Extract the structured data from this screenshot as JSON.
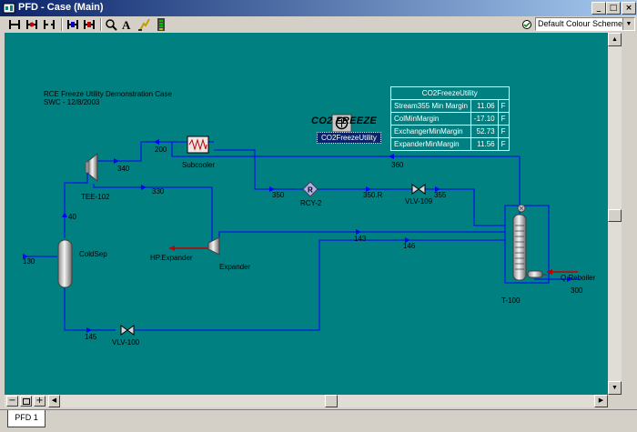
{
  "window": {
    "title": "PFD - Case (Main)"
  },
  "toolbar": {
    "icons": [
      "select-icon",
      "attach-icon",
      "break-icon",
      "auto-position-icon",
      "size-icon",
      "zoom-icon",
      "text-icon",
      "highlight-icon",
      "palette-icon"
    ],
    "colour_scheme": "Default Colour Scheme"
  },
  "pfd": {
    "case_title": "RCE Freeze Utility Demonstration Case",
    "case_subtitle": "SWC - 12/8/2003",
    "co2_freeze_title": "CO2 FREEZE",
    "co2_freeze_utility": "CO2FreezeUtility",
    "units": {
      "subcooler": "Subcooler",
      "tee": "TEE-102",
      "rcy": "RCY-2",
      "vlv109": "VLV-109",
      "coldsep": "ColdSep",
      "hp_expander": "HP.Expander",
      "expander": "Expander",
      "t100": "T-100",
      "q_reboiler": "Q.Reboiler",
      "vlv100": "VLV-100"
    },
    "streams": {
      "s200": "200",
      "s340": "340",
      "s330": "330",
      "s360": "360",
      "s350": "350",
      "s350r": "350.R",
      "s355": "355",
      "s40": "40",
      "s143": "143",
      "s146": "146",
      "s130": "130",
      "s300": "300",
      "s145": "145"
    }
  },
  "utility_table": {
    "title": "CO2FreezeUtility",
    "rows": [
      {
        "name": "Stream355 Min Margin",
        "value": "11.06",
        "unit": "F"
      },
      {
        "name": "ColMinMargin",
        "value": "-17.10",
        "unit": "F"
      },
      {
        "name": "ExchangerMinMargin",
        "value": "52.73",
        "unit": "F"
      },
      {
        "name": "ExpanderMinMargin",
        "value": "11.56",
        "unit": "F"
      }
    ]
  },
  "tabs": {
    "active": "PFD 1"
  },
  "colors": {
    "canvas": "#008080",
    "stream": "#0000ff",
    "energy": "#c00000"
  }
}
